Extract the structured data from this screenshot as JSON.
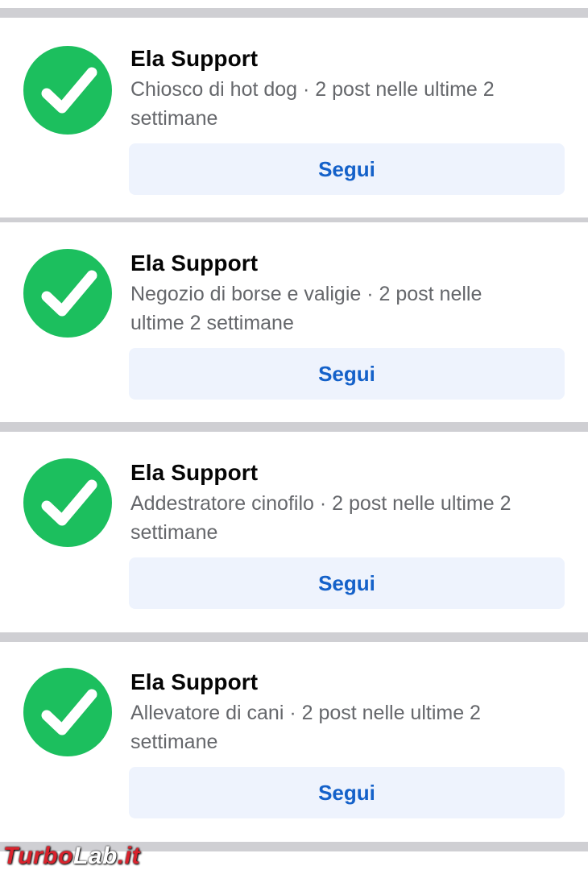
{
  "suggestions": [
    {
      "name": "Ela Support",
      "description": "Chiosco di hot dog · 2 post nelle ultime 2 settimane",
      "follow_label": "Segui",
      "avatar_icon": "green-checkmark-icon"
    },
    {
      "name": "Ela Support",
      "description": "Negozio di borse e valigie · 2 post nelle ultime 2 settimane",
      "follow_label": "Segui",
      "avatar_icon": "green-checkmark-icon"
    },
    {
      "name": "Ela Support",
      "description": "Addestratore cinofilo · 2 post nelle ultime 2 settimane",
      "follow_label": "Segui",
      "avatar_icon": "green-checkmark-icon"
    },
    {
      "name": "Ela Support",
      "description": "Allevatore di cani · 2 post nelle ultime 2 settimane",
      "follow_label": "Segui",
      "avatar_icon": "green-checkmark-icon"
    }
  ],
  "watermark": {
    "part1": "Turbo",
    "part2": "Lab",
    "part3": ".it"
  },
  "colors": {
    "avatar_green": "#1cbf5e",
    "follow_text": "#1461c9",
    "follow_bg": "#eef3fd",
    "divider": "#cfcfd3"
  }
}
